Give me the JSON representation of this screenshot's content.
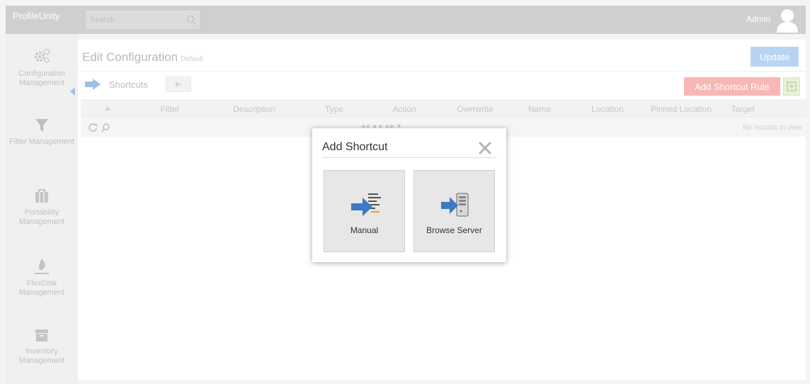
{
  "topbar": {
    "brand": "ProfileUnity",
    "search_placeholder": "Search",
    "admin_label": "Admin"
  },
  "sidebar": {
    "items": [
      {
        "label": "Configuration Management",
        "icon": "gears-icon"
      },
      {
        "label": "Filter Management",
        "icon": "filter-icon"
      },
      {
        "label": "Portability Management",
        "icon": "briefcase-icon"
      },
      {
        "label": "FlexDisk Management",
        "icon": "flexdisk-icon"
      },
      {
        "label": "Inventory Management",
        "icon": "inventory-icon"
      }
    ]
  },
  "main": {
    "title": "Edit Configuration",
    "subtitle": "Default",
    "update_label": "Update",
    "section_label": "Shortcuts",
    "add_rule_label": "Add Shortcut Rule",
    "columns": [
      "Filter",
      "Description",
      "Type",
      "Action",
      "Overwrite",
      "Name",
      "Location",
      "Pinned Location",
      "Target"
    ],
    "no_records": "No records to view"
  },
  "dialog": {
    "title": "Add Shortcut",
    "options": [
      {
        "label": "Manual",
        "icon": "manual-shortcut-icon"
      },
      {
        "label": "Browse Server",
        "icon": "browse-server-icon"
      }
    ]
  },
  "colors": {
    "topbar": "#cfcfcf",
    "update_button": "#b9d4f2",
    "add_rule_button": "#f7b7b4",
    "arrow_blue": "#3d79c4",
    "arrow_orange": "#f39c1f",
    "tile_bg": "#e7e7e7"
  }
}
